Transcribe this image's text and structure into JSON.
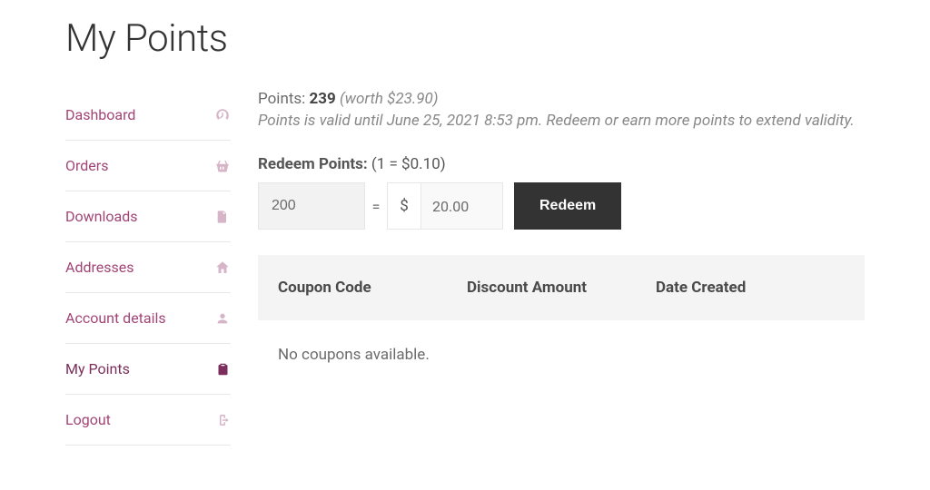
{
  "title": "My Points",
  "sidebar": {
    "items": [
      {
        "label": "Dashboard",
        "icon": "dashboard"
      },
      {
        "label": "Orders",
        "icon": "basket"
      },
      {
        "label": "Downloads",
        "icon": "file"
      },
      {
        "label": "Addresses",
        "icon": "home"
      },
      {
        "label": "Account details",
        "icon": "user"
      },
      {
        "label": "My Points",
        "icon": "clipboard",
        "active": true
      },
      {
        "label": "Logout",
        "icon": "signout"
      }
    ]
  },
  "points": {
    "label": "Points:",
    "value": "239",
    "worth": "(worth $23.90)",
    "validity": "Points is valid until June 25, 2021 8:53 pm. Redeem or earn more points to extend validity."
  },
  "redeem": {
    "title_bold": "Redeem Points:",
    "title_rest": " (1 = $0.10)",
    "points_input": "200",
    "currency_symbol": "$",
    "amount": "20.00",
    "button": "Redeem"
  },
  "coupons": {
    "col1": "Coupon Code",
    "col2": "Discount Amount",
    "col3": "Date Created",
    "empty": "No coupons available."
  }
}
